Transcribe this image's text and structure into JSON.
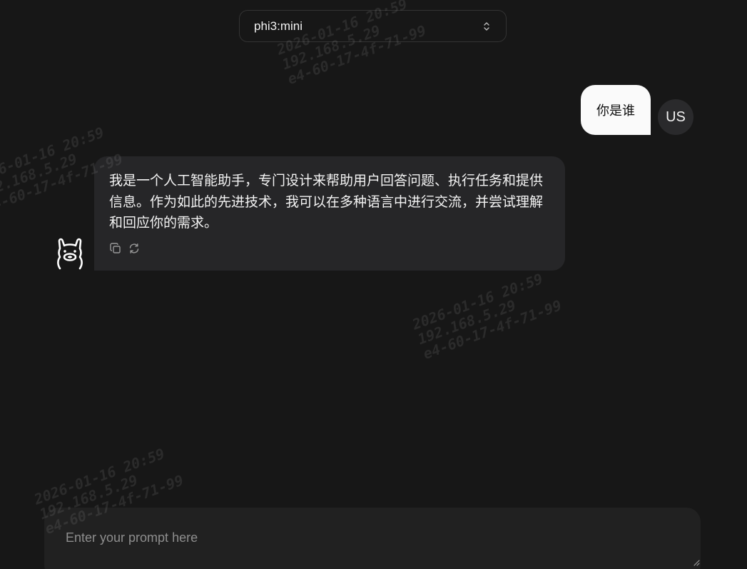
{
  "header": {
    "model_selector": {
      "value": "phi3:mini",
      "icon": "chevron-up-down-icon"
    }
  },
  "messages": [
    {
      "role": "user",
      "text": "你是谁",
      "avatar_label": "US"
    },
    {
      "role": "assistant",
      "text": "我是一个人工智能助手，专门设计来帮助用户回答问题、执行任务和提供信息。作为如此的先进技术，我可以在多种语言中进行交流，并尝试理解和回应你的需求。",
      "avatar_icon": "llama-icon",
      "actions": [
        {
          "icon": "copy-icon"
        },
        {
          "icon": "regenerate-icon"
        }
      ]
    }
  ],
  "prompt": {
    "placeholder": "Enter your prompt here",
    "value": ""
  },
  "watermark": {
    "line1": "2026-01-16 20:59",
    "line2": "192.168.5.29",
    "line3": "e4-60-17-4f-71-99"
  },
  "colors": {
    "background": "#171717",
    "user_bubble": "#fafafa",
    "assistant_bubble": "#262628",
    "input": "#212121"
  }
}
